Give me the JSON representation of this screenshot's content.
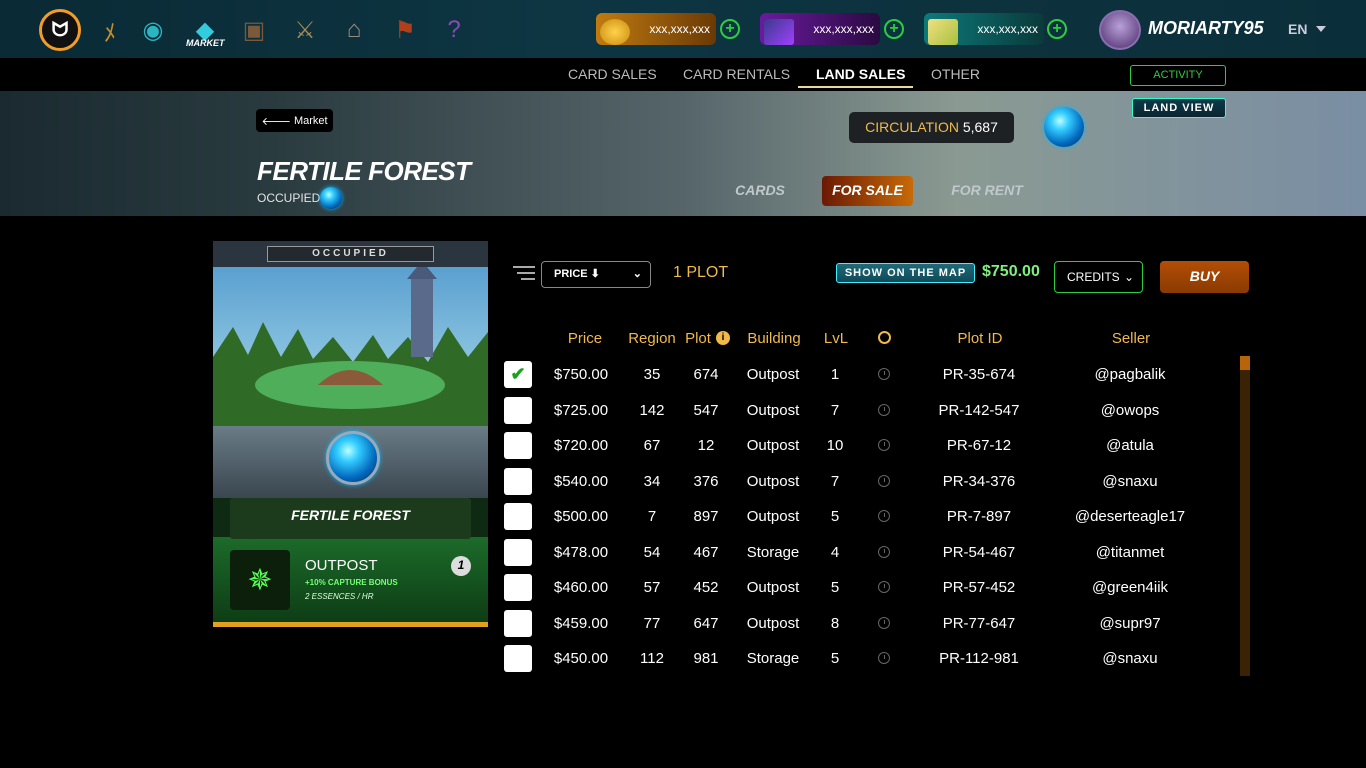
{
  "topbar": {
    "icons": [
      "logo-icon",
      "quest-icon",
      "portal-icon",
      "market-icon",
      "inventory-icon",
      "battle-icon",
      "land-icon",
      "guild-icon",
      "help-icon"
    ],
    "market_label": "MARKET",
    "wallets": [
      {
        "name": "dec",
        "value": "xxx,xxx,xxx",
        "color": "#8a4a08"
      },
      {
        "name": "sps",
        "value": "xxx,xxx,xxx",
        "color": "#3a1a55"
      },
      {
        "name": "credits",
        "value": "xxx,xxx,xxx",
        "color": "#0b4a4a"
      }
    ],
    "username": "MORIARTY95",
    "language": "EN"
  },
  "subnav": {
    "tabs": [
      "CARD SALES",
      "CARD RENTALS",
      "LAND SALES",
      "OTHER"
    ],
    "active": "LAND SALES",
    "activity_label": "ACTIVITY",
    "land_view_label": "LAND VIEW"
  },
  "hero": {
    "back_label": "Market",
    "circulation_label": "CIRCULATION",
    "circulation_value": "5,687",
    "title": "FERTILE FOREST",
    "status": "OCCUPIED",
    "tabs": [
      "CARDS",
      "FOR SALE",
      "FOR RENT"
    ],
    "active_tab": "FOR SALE"
  },
  "card": {
    "status": "OCCUPIED",
    "name": "FERTILE FOREST",
    "building": "OUTPOST",
    "bonus": "+10% CAPTURE BONUS",
    "essence": "2 ESSENCES / HR",
    "level": "1"
  },
  "toolbar": {
    "sort_label": "PRICE ⬇",
    "plot_count": "1 PLOT",
    "show_map_label": "SHOW ON THE MAP",
    "selected_total": "$750.00",
    "currency": "CREDITS",
    "buy_label": "BUY"
  },
  "table": {
    "headers": [
      "Price",
      "Region",
      "Plot",
      "Building",
      "LvL",
      "Plot ID",
      "Seller"
    ],
    "rows": [
      {
        "checked": true,
        "price": "$750.00",
        "region": "35",
        "plot": "674",
        "building": "Outpost",
        "lvl": "1",
        "plot_id": "PR-35-674",
        "seller": "@pagbalik"
      },
      {
        "checked": false,
        "price": "$725.00",
        "region": "142",
        "plot": "547",
        "building": "Outpost",
        "lvl": "7",
        "plot_id": "PR-142-547",
        "seller": "@owops"
      },
      {
        "checked": false,
        "price": "$720.00",
        "region": "67",
        "plot": "12",
        "building": "Outpost",
        "lvl": "10",
        "plot_id": "PR-67-12",
        "seller": "@atula"
      },
      {
        "checked": false,
        "price": "$540.00",
        "region": "34",
        "plot": "376",
        "building": "Outpost",
        "lvl": "7",
        "plot_id": "PR-34-376",
        "seller": "@snaxu"
      },
      {
        "checked": false,
        "price": "$500.00",
        "region": "7",
        "plot": "897",
        "building": "Outpost",
        "lvl": "5",
        "plot_id": "PR-7-897",
        "seller": "@deserteagle17"
      },
      {
        "checked": false,
        "price": "$478.00",
        "region": "54",
        "plot": "467",
        "building": "Storage",
        "lvl": "4",
        "plot_id": "PR-54-467",
        "seller": "@titanmet"
      },
      {
        "checked": false,
        "price": "$460.00",
        "region": "57",
        "plot": "452",
        "building": "Outpost",
        "lvl": "5",
        "plot_id": "PR-57-452",
        "seller": "@green4iik"
      },
      {
        "checked": false,
        "price": "$459.00",
        "region": "77",
        "plot": "647",
        "building": "Outpost",
        "lvl": "8",
        "plot_id": "PR-77-647",
        "seller": "@supr97"
      },
      {
        "checked": false,
        "price": "$450.00",
        "region": "112",
        "plot": "981",
        "building": "Storage",
        "lvl": "5",
        "plot_id": "PR-112-981",
        "seller": "@snaxu"
      }
    ]
  },
  "colors": {
    "accent": "#f0b94a",
    "buy": "#b34e06",
    "check": "#1aa31a"
  }
}
